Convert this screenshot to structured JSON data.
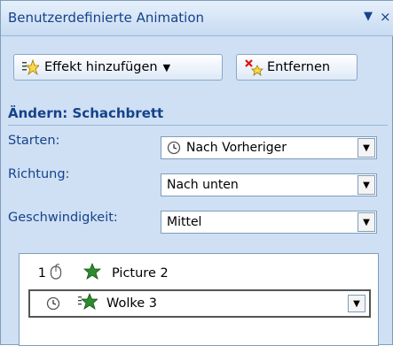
{
  "pane": {
    "title": "Benutzerdefinierte Animation",
    "menu_arrow": "▼",
    "close": "×"
  },
  "toolbar": {
    "add_label": "Effekt hinzufügen",
    "add_arrow": "▼",
    "remove_label": "Entfernen"
  },
  "section": {
    "title": "Ändern: Schachbrett"
  },
  "fields": {
    "start_label": "Starten:",
    "start_value": "Nach Vorheriger",
    "direction_label": "Richtung:",
    "direction_value": "Nach unten",
    "speed_label": "Geschwindigkeit:",
    "speed_value": "Mittel",
    "arrow_glyph": "▼"
  },
  "animation_list": {
    "items": [
      {
        "number": "1",
        "label": "Picture 2"
      },
      {
        "number": "",
        "label": "Wolke 3"
      }
    ]
  },
  "colors": {
    "accent": "#15428b",
    "pane_bg": "#cfe0f4",
    "star_green": "#2e8b2e"
  }
}
